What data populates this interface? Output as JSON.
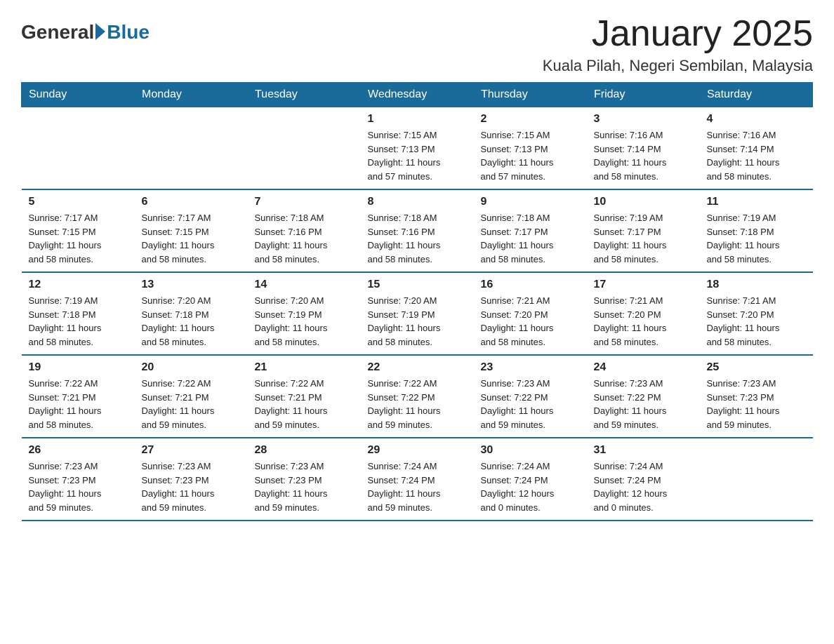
{
  "header": {
    "logo": {
      "general": "General",
      "arrow": "",
      "blue": "Blue"
    },
    "title": "January 2025",
    "location": "Kuala Pilah, Negeri Sembilan, Malaysia"
  },
  "weekdays": [
    "Sunday",
    "Monday",
    "Tuesday",
    "Wednesday",
    "Thursday",
    "Friday",
    "Saturday"
  ],
  "weeks": [
    [
      {
        "day": "",
        "info": ""
      },
      {
        "day": "",
        "info": ""
      },
      {
        "day": "",
        "info": ""
      },
      {
        "day": "1",
        "info": "Sunrise: 7:15 AM\nSunset: 7:13 PM\nDaylight: 11 hours\nand 57 minutes."
      },
      {
        "day": "2",
        "info": "Sunrise: 7:15 AM\nSunset: 7:13 PM\nDaylight: 11 hours\nand 57 minutes."
      },
      {
        "day": "3",
        "info": "Sunrise: 7:16 AM\nSunset: 7:14 PM\nDaylight: 11 hours\nand 58 minutes."
      },
      {
        "day": "4",
        "info": "Sunrise: 7:16 AM\nSunset: 7:14 PM\nDaylight: 11 hours\nand 58 minutes."
      }
    ],
    [
      {
        "day": "5",
        "info": "Sunrise: 7:17 AM\nSunset: 7:15 PM\nDaylight: 11 hours\nand 58 minutes."
      },
      {
        "day": "6",
        "info": "Sunrise: 7:17 AM\nSunset: 7:15 PM\nDaylight: 11 hours\nand 58 minutes."
      },
      {
        "day": "7",
        "info": "Sunrise: 7:18 AM\nSunset: 7:16 PM\nDaylight: 11 hours\nand 58 minutes."
      },
      {
        "day": "8",
        "info": "Sunrise: 7:18 AM\nSunset: 7:16 PM\nDaylight: 11 hours\nand 58 minutes."
      },
      {
        "day": "9",
        "info": "Sunrise: 7:18 AM\nSunset: 7:17 PM\nDaylight: 11 hours\nand 58 minutes."
      },
      {
        "day": "10",
        "info": "Sunrise: 7:19 AM\nSunset: 7:17 PM\nDaylight: 11 hours\nand 58 minutes."
      },
      {
        "day": "11",
        "info": "Sunrise: 7:19 AM\nSunset: 7:18 PM\nDaylight: 11 hours\nand 58 minutes."
      }
    ],
    [
      {
        "day": "12",
        "info": "Sunrise: 7:19 AM\nSunset: 7:18 PM\nDaylight: 11 hours\nand 58 minutes."
      },
      {
        "day": "13",
        "info": "Sunrise: 7:20 AM\nSunset: 7:18 PM\nDaylight: 11 hours\nand 58 minutes."
      },
      {
        "day": "14",
        "info": "Sunrise: 7:20 AM\nSunset: 7:19 PM\nDaylight: 11 hours\nand 58 minutes."
      },
      {
        "day": "15",
        "info": "Sunrise: 7:20 AM\nSunset: 7:19 PM\nDaylight: 11 hours\nand 58 minutes."
      },
      {
        "day": "16",
        "info": "Sunrise: 7:21 AM\nSunset: 7:20 PM\nDaylight: 11 hours\nand 58 minutes."
      },
      {
        "day": "17",
        "info": "Sunrise: 7:21 AM\nSunset: 7:20 PM\nDaylight: 11 hours\nand 58 minutes."
      },
      {
        "day": "18",
        "info": "Sunrise: 7:21 AM\nSunset: 7:20 PM\nDaylight: 11 hours\nand 58 minutes."
      }
    ],
    [
      {
        "day": "19",
        "info": "Sunrise: 7:22 AM\nSunset: 7:21 PM\nDaylight: 11 hours\nand 58 minutes."
      },
      {
        "day": "20",
        "info": "Sunrise: 7:22 AM\nSunset: 7:21 PM\nDaylight: 11 hours\nand 59 minutes."
      },
      {
        "day": "21",
        "info": "Sunrise: 7:22 AM\nSunset: 7:21 PM\nDaylight: 11 hours\nand 59 minutes."
      },
      {
        "day": "22",
        "info": "Sunrise: 7:22 AM\nSunset: 7:22 PM\nDaylight: 11 hours\nand 59 minutes."
      },
      {
        "day": "23",
        "info": "Sunrise: 7:23 AM\nSunset: 7:22 PM\nDaylight: 11 hours\nand 59 minutes."
      },
      {
        "day": "24",
        "info": "Sunrise: 7:23 AM\nSunset: 7:22 PM\nDaylight: 11 hours\nand 59 minutes."
      },
      {
        "day": "25",
        "info": "Sunrise: 7:23 AM\nSunset: 7:23 PM\nDaylight: 11 hours\nand 59 minutes."
      }
    ],
    [
      {
        "day": "26",
        "info": "Sunrise: 7:23 AM\nSunset: 7:23 PM\nDaylight: 11 hours\nand 59 minutes."
      },
      {
        "day": "27",
        "info": "Sunrise: 7:23 AM\nSunset: 7:23 PM\nDaylight: 11 hours\nand 59 minutes."
      },
      {
        "day": "28",
        "info": "Sunrise: 7:23 AM\nSunset: 7:23 PM\nDaylight: 11 hours\nand 59 minutes."
      },
      {
        "day": "29",
        "info": "Sunrise: 7:24 AM\nSunset: 7:24 PM\nDaylight: 11 hours\nand 59 minutes."
      },
      {
        "day": "30",
        "info": "Sunrise: 7:24 AM\nSunset: 7:24 PM\nDaylight: 12 hours\nand 0 minutes."
      },
      {
        "day": "31",
        "info": "Sunrise: 7:24 AM\nSunset: 7:24 PM\nDaylight: 12 hours\nand 0 minutes."
      },
      {
        "day": "",
        "info": ""
      }
    ]
  ]
}
